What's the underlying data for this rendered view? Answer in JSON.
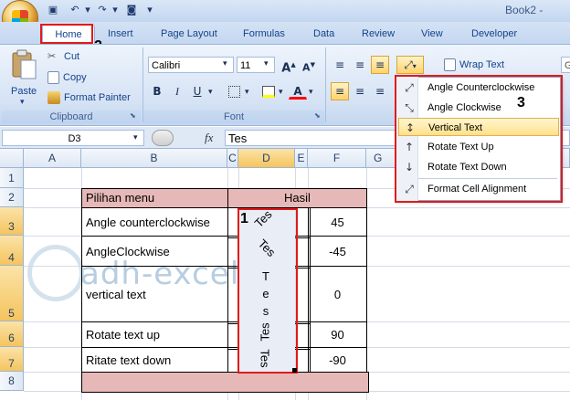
{
  "window": {
    "title": "Book2 - "
  },
  "quick_access": {
    "save_icon": "save-icon",
    "undo_icon": "undo-icon",
    "redo_icon": "redo-icon",
    "camera_icon": "camera-icon"
  },
  "tabs": [
    "Home",
    "Insert",
    "Page Layout",
    "Formulas",
    "Data",
    "Review",
    "View",
    "Developer"
  ],
  "markers": {
    "home": "2",
    "cell": "1",
    "menu": "3"
  },
  "clipboard": {
    "paste": "Paste",
    "cut": "Cut",
    "copy": "Copy",
    "format_painter": "Format Painter",
    "group": "Clipboard"
  },
  "font": {
    "name": "Calibri",
    "size": "11",
    "grow": "A",
    "shrink": "A",
    "bold": "B",
    "italic": "I",
    "underline": "U",
    "color_letter": "A",
    "group": "Font"
  },
  "alignment": {
    "wrap_text": "Wrap Text",
    "cut_right": "G"
  },
  "orientation_menu": {
    "items": [
      "Angle Counterclockwise",
      "Angle Clockwise",
      "Vertical Text",
      "Rotate Text Up",
      "Rotate Text Down",
      "Format Cell Alignment"
    ],
    "selected_index": 2
  },
  "formula_bar": {
    "name_box": "D3",
    "fx": "fx",
    "content": "Tes"
  },
  "sheet": {
    "columns": [
      "A",
      "B",
      "C",
      "D",
      "E",
      "F",
      "G"
    ],
    "rows": [
      "1",
      "2",
      "3",
      "4",
      "5",
      "6",
      "7",
      "8"
    ],
    "header": {
      "menu": "Pilihan menu",
      "result": "Hasil"
    },
    "rows_data": [
      {
        "label": "Angle counterclockwise",
        "text": "Tes",
        "value": "45"
      },
      {
        "label": "AngleClockwise",
        "text": "Tes",
        "value": "-45"
      },
      {
        "label": "vertical text",
        "text": "T e s",
        "value": "0"
      },
      {
        "label": "Rotate text up",
        "text": "Tes",
        "value": "90"
      },
      {
        "label": "Ritate text down",
        "text": "Tes",
        "value": "-90"
      }
    ],
    "watermark": "adh-excel"
  },
  "colors": {
    "header_fill": "#e6b8b7",
    "selection_border": "#e11a1a",
    "accent": "#15428b"
  }
}
